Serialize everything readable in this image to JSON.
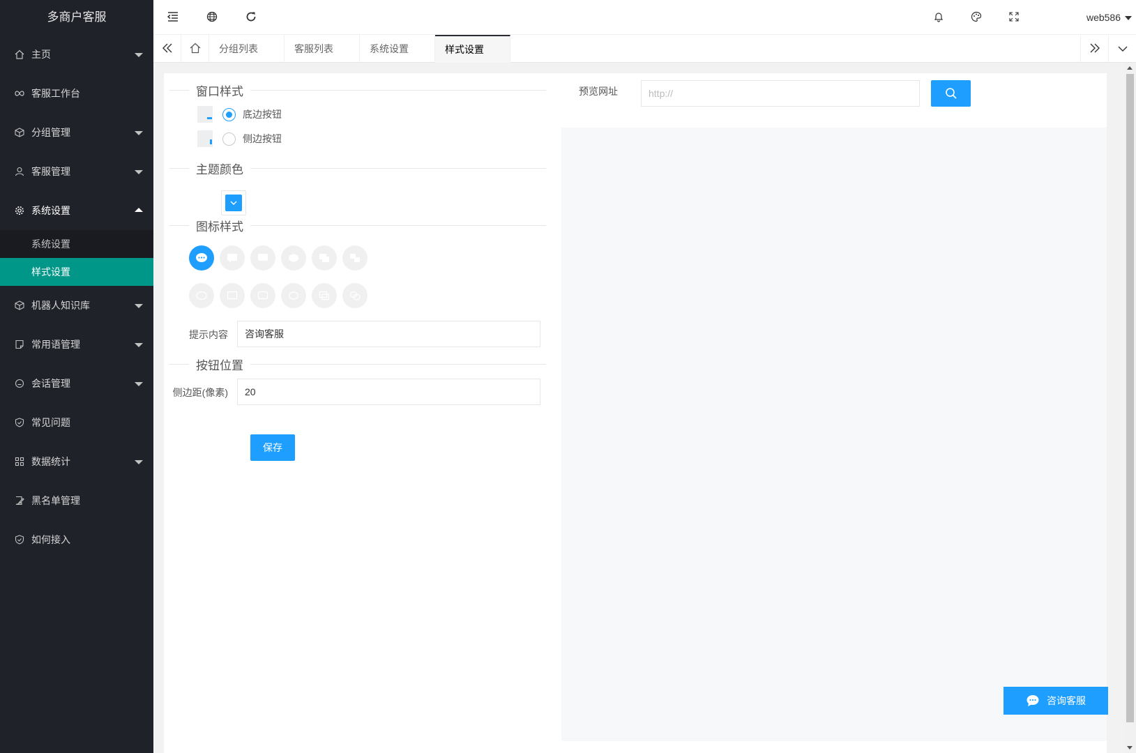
{
  "app": {
    "title": "多商户客服"
  },
  "sidebar": {
    "items": [
      {
        "label": "主页",
        "icon": "home-icon",
        "caret": true
      },
      {
        "label": "客服工作台",
        "icon": "infinity-icon",
        "caret": false
      },
      {
        "label": "分组管理",
        "icon": "cube-icon",
        "caret": true
      },
      {
        "label": "客服管理",
        "icon": "user-icon",
        "caret": true
      },
      {
        "label": "系统设置",
        "icon": "gear-icon",
        "caret": true,
        "open": true,
        "children": [
          {
            "label": "系统设置"
          },
          {
            "label": "样式设置",
            "active": true
          }
        ]
      },
      {
        "label": "机器人知识库",
        "icon": "cube-icon",
        "caret": true
      },
      {
        "label": "常用语管理",
        "icon": "note-icon",
        "caret": true
      },
      {
        "label": "会话管理",
        "icon": "chat-circle-icon",
        "caret": true
      },
      {
        "label": "常见问题",
        "icon": "shield-icon",
        "caret": false
      },
      {
        "label": "数据统计",
        "icon": "grid-icon",
        "caret": true
      },
      {
        "label": "黑名单管理",
        "icon": "edit-icon",
        "caret": false
      },
      {
        "label": "如何接入",
        "icon": "shield-icon",
        "caret": false
      }
    ]
  },
  "header": {
    "username": "web586"
  },
  "tabs": {
    "items": [
      {
        "label": "分组列表"
      },
      {
        "label": "客服列表"
      },
      {
        "label": "系统设置"
      },
      {
        "label": "样式设置",
        "active": true
      }
    ]
  },
  "form": {
    "window_style": {
      "title": "窗口样式",
      "options": [
        {
          "label": "底边按钮",
          "checked": true
        },
        {
          "label": "侧边按钮",
          "checked": false
        }
      ]
    },
    "theme_color": {
      "title": "主题颜色",
      "value": "#1e9fff"
    },
    "icon_style": {
      "title": "图标样式",
      "selected_index": 0
    },
    "tip_content": {
      "label": "提示内容",
      "value": "咨询客服"
    },
    "button_position": {
      "title": "按钮位置"
    },
    "side_margin": {
      "label": "侧边距(像素)",
      "value": "20"
    },
    "save_label": "保存"
  },
  "preview": {
    "label": "预览网址",
    "placeholder": "http://",
    "float_button_label": "咨询客服"
  },
  "colors": {
    "sidebar_bg": "#20222a",
    "active_teal": "#009688",
    "primary_blue": "#1e9fff"
  }
}
